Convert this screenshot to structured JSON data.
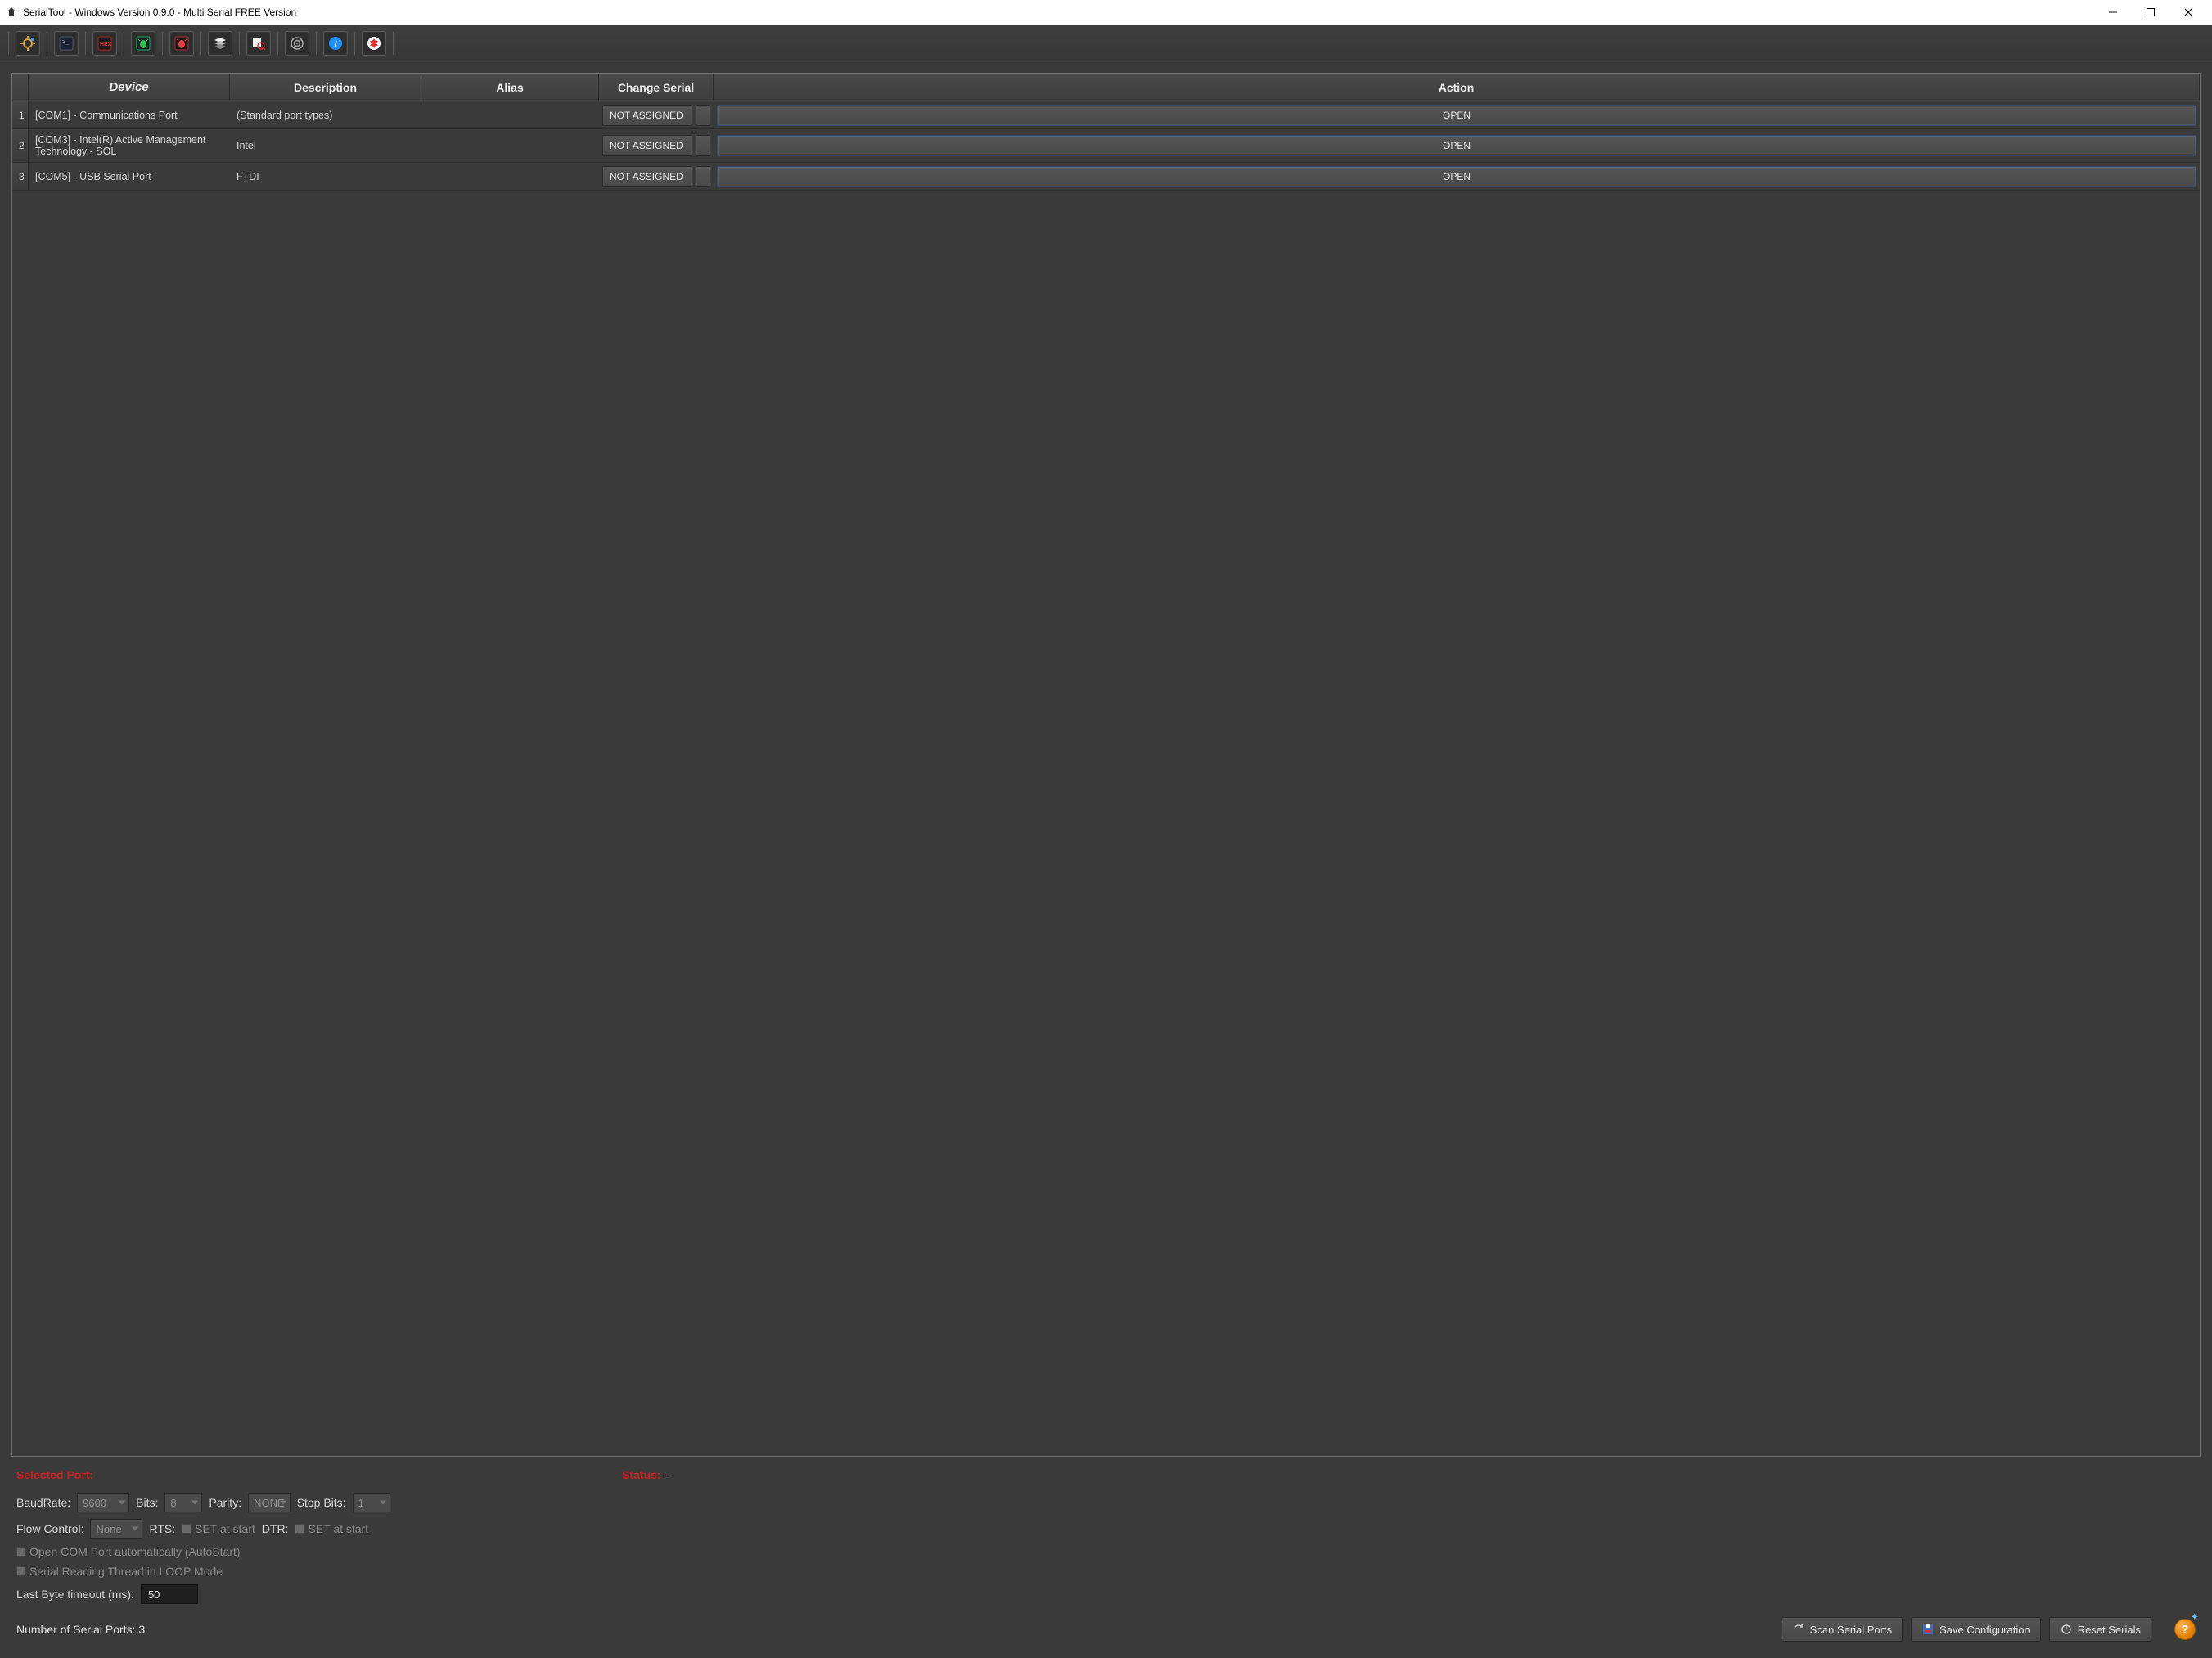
{
  "titlebar": {
    "title": "SerialTool - Windows Version 0.9.0 - Multi Serial FREE Version"
  },
  "table": {
    "headers": {
      "num": "",
      "device": "Device",
      "description": "Description",
      "alias": "Alias",
      "change": "Change Serial",
      "action": "Action"
    },
    "rows": [
      {
        "num": "1",
        "device": "[COM1] - Communications Port",
        "description": "(Standard port types)",
        "alias": "",
        "change": "NOT ASSIGNED",
        "action": "OPEN"
      },
      {
        "num": "2",
        "device": "[COM3] - Intel(R) Active Management Technology - SOL",
        "description": "Intel",
        "alias": "",
        "change": "NOT ASSIGNED",
        "action": "OPEN"
      },
      {
        "num": "3",
        "device": "[COM5] - USB Serial Port",
        "description": "FTDI",
        "alias": "",
        "change": "NOT ASSIGNED",
        "action": "OPEN"
      }
    ]
  },
  "status": {
    "selected_port_label": "Selected Port:",
    "selected_port_value": "",
    "status_label": "Status:",
    "status_value": "-"
  },
  "settings": {
    "baudrate_label": "BaudRate:",
    "baudrate_value": "9600",
    "bits_label": "Bits:",
    "bits_value": "8",
    "parity_label": "Parity:",
    "parity_value": "NONE",
    "stopbits_label": "Stop Bits:",
    "stopbits_value": "1",
    "flow_label": "Flow Control:",
    "flow_value": "None",
    "rts_label": "RTS:",
    "rts_hint": "SET at start",
    "dtr_label": "DTR:",
    "dtr_hint": "SET at start",
    "autostart_label": "Open COM Port automatically (AutoStart)",
    "loop_label": "Serial Reading Thread in LOOP Mode",
    "lastbyte_label": "Last Byte timeout (ms):",
    "lastbyte_value": "50"
  },
  "footer": {
    "ports_count": "Number of Serial Ports: 3",
    "scan_label": "Scan Serial Ports",
    "save_label": "Save Configuration",
    "reset_label": "Reset Serials",
    "help_glyph": "?"
  }
}
